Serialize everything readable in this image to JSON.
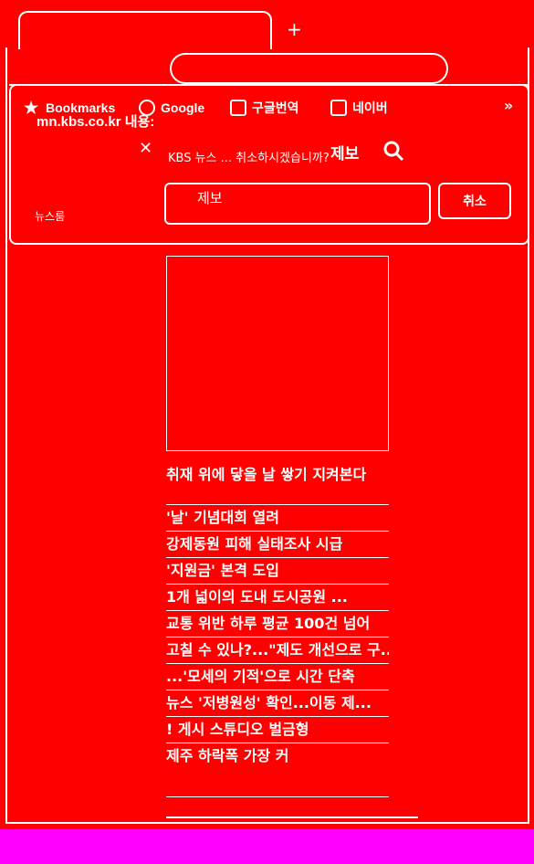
{
  "browser": {
    "new_tab_label": "+",
    "bookmarks": [
      {
        "label": "Bookmarks",
        "icon": "star-icon"
      },
      {
        "label": "Google",
        "icon": "google-icon"
      },
      {
        "label": "구글번역",
        "icon": "translate-icon"
      },
      {
        "label": "네이버",
        "icon": "naver-icon"
      }
    ],
    "more_label": "»"
  },
  "dialog": {
    "site": "mn.kbs.co.kr 내용:",
    "question": "KBS 뉴스 ... 취소하시겠습니까?",
    "field_label": "제보",
    "cancel_label": "취소",
    "newsroom_label": "뉴스룸"
  },
  "page": {
    "tip_label": "제보",
    "feature_title": "취재 위에 닿을 날 쌓기 지켜본다",
    "news": [
      "'날' 기념대회 열려",
      "강제동원 피해 실태조사 시급",
      "'지원금' 본격 도입",
      "1개 넓이의 도내 도시공원 ...",
      "교통 위반 하루 평균 100건 넘어",
      "고칠 수 있나?...\"제도 개선으로 구...",
      "...'모세의 기적'으로 시간 단축",
      "뉴스 '저병원성' 확인...이동 제...",
      "! 게시 스튜디오 벌금형",
      "제주 하락폭 가장 커"
    ]
  }
}
